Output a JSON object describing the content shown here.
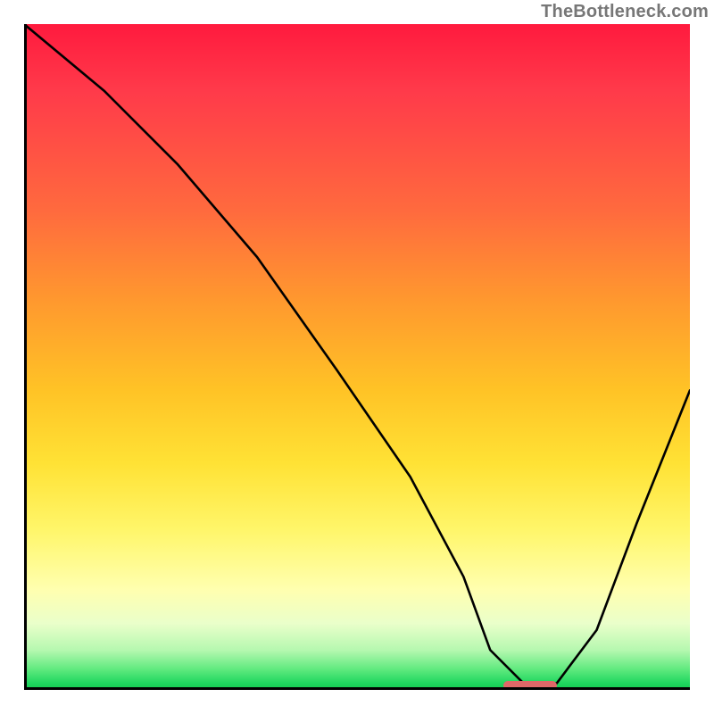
{
  "watermark": "TheBottleneck.com",
  "chart_data": {
    "type": "line",
    "title": "",
    "xlabel": "",
    "ylabel": "",
    "xlim": [
      0,
      100
    ],
    "ylim": [
      0,
      100
    ],
    "grid": false,
    "series": [
      {
        "name": "curve",
        "x": [
          0,
          12,
          23,
          35,
          47,
          58,
          66,
          70,
          75,
          80,
          86,
          92,
          100
        ],
        "values": [
          100,
          90,
          79,
          65,
          48,
          32,
          17,
          6,
          1,
          1,
          9,
          25,
          45
        ]
      }
    ],
    "annotations": {
      "minimum_marker": {
        "x_start": 72,
        "x_end": 80,
        "y": 0.7,
        "color": "#e06868"
      }
    },
    "background_gradient": {
      "direction": "vertical",
      "stops": [
        {
          "pos": 0,
          "color": "#ff1a3e"
        },
        {
          "pos": 50,
          "color": "#ffc326"
        },
        {
          "pos": 80,
          "color": "#ffffb0"
        },
        {
          "pos": 100,
          "color": "#14c94f"
        }
      ]
    }
  }
}
